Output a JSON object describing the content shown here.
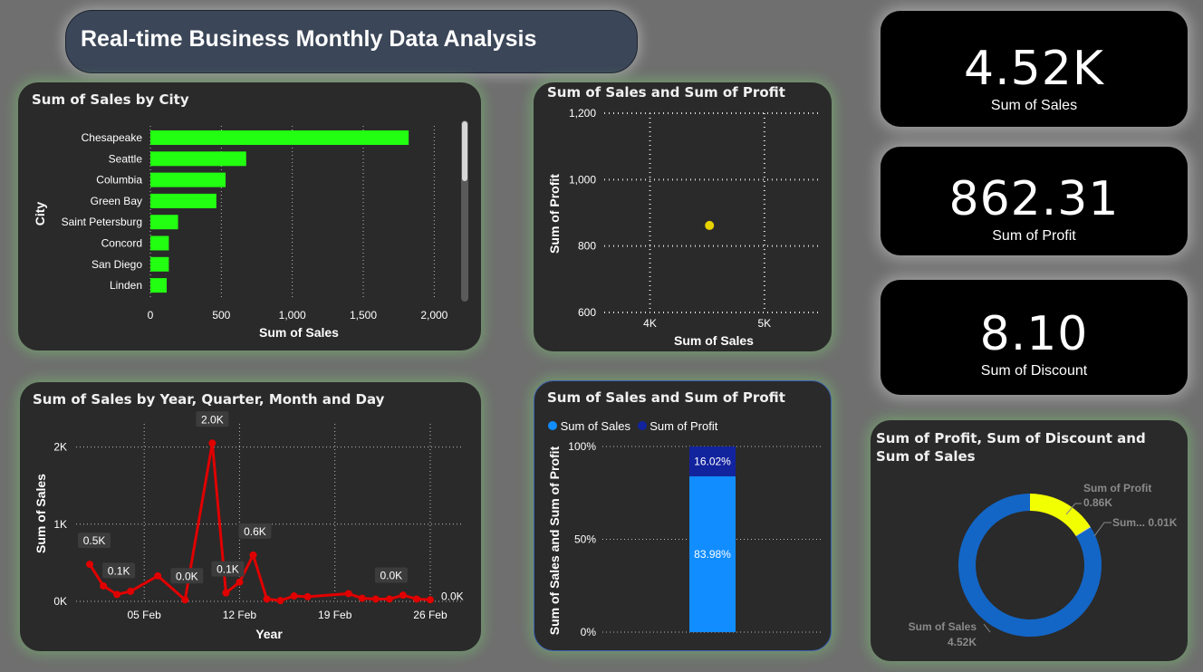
{
  "dashboard": {
    "title": "Real-time Business Monthly Data Analysis"
  },
  "kpis": [
    {
      "value": "4.52K",
      "label": "Sum of Sales"
    },
    {
      "value": "862.31",
      "label": "Sum of Profit"
    },
    {
      "value": "8.10",
      "label": "Sum of Discount"
    }
  ],
  "colors": {
    "bar": "#22ff11",
    "line": "#e00000",
    "sales_blue": "#118dff",
    "profit_navy": "#12239e",
    "donut_yellow": "#f2ff00",
    "donut_blue": "#1366c6",
    "scatter_point": "#e8d200"
  },
  "chart_data": [
    {
      "type": "bar",
      "title": "Sum of Sales by City",
      "xlabel": "Sum of Sales",
      "ylabel": "City",
      "categories": [
        "Chesapeake",
        "Seattle",
        "Columbia",
        "Green Bay",
        "Saint Petersburg",
        "Concord",
        "San Diego",
        "Linden"
      ],
      "values": [
        1820,
        675,
        530,
        465,
        195,
        130,
        130,
        115
      ],
      "xlim": [
        0,
        2100
      ],
      "xticks": [
        "0",
        "500",
        "1,000",
        "1,500",
        "2,000"
      ],
      "grid": true
    },
    {
      "type": "scatter",
      "title": "Sum of Sales and Sum of Profit",
      "xlabel": "Sum of Sales",
      "ylabel": "Sum of Profit",
      "points": [
        {
          "x": 4520,
          "y": 862
        }
      ],
      "xticks": [
        "4K",
        "5K"
      ],
      "yticks": [
        "600",
        "800",
        "1,000",
        "1,200"
      ],
      "xlim": [
        3600,
        5500
      ],
      "ylim": [
        600,
        1200
      ],
      "grid": true
    },
    {
      "type": "line",
      "title": "Sum of Sales by Year, Quarter, Month and Day",
      "xlabel": "Year",
      "ylabel": "Sum of Sales",
      "x": [
        1,
        2,
        3,
        4,
        6,
        8,
        10,
        11,
        12,
        13,
        14,
        15,
        16,
        17,
        20,
        21,
        22,
        23,
        24,
        25,
        26
      ],
      "y": [
        480,
        200,
        90,
        130,
        330,
        20,
        2050,
        110,
        250,
        600,
        30,
        10,
        70,
        60,
        100,
        40,
        30,
        30,
        80,
        30,
        20
      ],
      "xticks": [
        "05 Feb",
        "12 Feb",
        "19 Feb",
        "26 Feb"
      ],
      "yticks": [
        "0K",
        "1K",
        "2K"
      ],
      "data_labels": [
        "0.5K",
        "0.1K",
        "0.0K",
        "2.0K",
        "0.1K",
        "0.6K",
        "0.0K",
        "0.0K"
      ],
      "ylim": [
        0,
        2300
      ],
      "grid": true
    },
    {
      "type": "bar",
      "title": "Sum of Sales and Sum of Profit",
      "ylabel": "Sum of Sales and Sum of Profit",
      "series": [
        {
          "name": "Sum of Sales",
          "values": [
            83.98
          ],
          "label": "83.98%"
        },
        {
          "name": "Sum of Profit",
          "values": [
            16.02
          ],
          "label": "16.02%"
        }
      ],
      "yticks": [
        "0%",
        "50%",
        "100%"
      ],
      "ylim": [
        0,
        100
      ],
      "legend": "top-left",
      "stacked": true
    },
    {
      "type": "pie",
      "title": "Sum of Profit, Sum of Discount and Sum of Sales",
      "slices": [
        {
          "name": "Sum of Profit",
          "value": 0.86,
          "label": "Sum of Profit",
          "value_label": "0.86K"
        },
        {
          "name": "Sum of Discount",
          "value": 0.01,
          "label": "Sum... 0.01K"
        },
        {
          "name": "Sum of Sales",
          "value": 4.52,
          "label": "Sum of Sales",
          "value_label": "4.52K"
        }
      ],
      "donut": true
    }
  ]
}
